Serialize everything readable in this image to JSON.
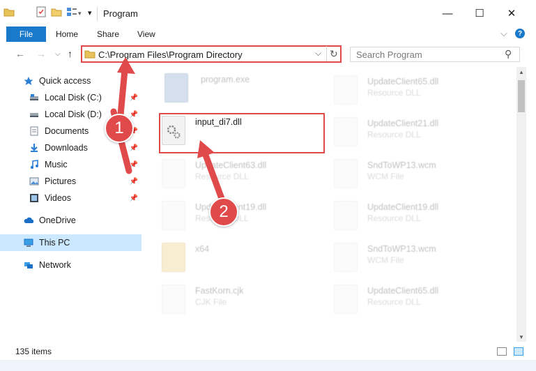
{
  "window": {
    "title": "Program",
    "minimize_glyph": "—",
    "maximize_glyph": "☐",
    "close_glyph": "✕"
  },
  "ribbon": {
    "tabs": [
      "File",
      "Home",
      "Share",
      "View"
    ],
    "help_glyph": "?",
    "expand_glyph": "⌵"
  },
  "nav": {
    "back_glyph": "←",
    "forward_glyph": "→",
    "recent_glyph": "⌵",
    "up_glyph": "↑",
    "address_path": "C:\\Program Files\\Program Directory",
    "address_dropdown_glyph": "⌵",
    "refresh_glyph": "↻",
    "search_placeholder": "Search Program",
    "search_glyph": "⚲"
  },
  "sidebar": {
    "items": [
      {
        "label": "Quick access",
        "icon": "star-icon",
        "pinned": false
      },
      {
        "label": "Local Disk (C:)",
        "icon": "drive-icon",
        "pinned": true
      },
      {
        "label": "Local Disk (D:)",
        "icon": "drive-icon",
        "pinned": true
      },
      {
        "label": "Documents",
        "icon": "documents-icon",
        "pinned": true
      },
      {
        "label": "Downloads",
        "icon": "download-icon",
        "pinned": true
      },
      {
        "label": "Music",
        "icon": "music-icon",
        "pinned": true
      },
      {
        "label": "Pictures",
        "icon": "pictures-icon",
        "pinned": true
      },
      {
        "label": "Videos",
        "icon": "videos-icon",
        "pinned": true
      },
      {
        "label": "OneDrive",
        "icon": "cloud-icon",
        "pinned": false
      },
      {
        "label": "This PC",
        "icon": "computer-icon",
        "pinned": false,
        "selected": true
      },
      {
        "label": "Network",
        "icon": "network-icon",
        "pinned": false
      }
    ],
    "pin_glyph": "📌"
  },
  "files": {
    "left": [
      {
        "name": "program.exe",
        "type": ""
      },
      {
        "name": "input_di7.dll",
        "type": ""
      },
      {
        "name": "UpdateClient63.dll",
        "type": "Resource DLL"
      },
      {
        "name": "UpdateClient19.dll",
        "type": "Resource DLL"
      },
      {
        "name": "x64",
        "type": ""
      },
      {
        "name": "FastKorn.cjk",
        "type": "CJK File"
      }
    ],
    "right": [
      {
        "name": "UpdateClient65.dll",
        "type": "Resource DLL"
      },
      {
        "name": "UpdateClient21.dll",
        "type": "Resource DLL"
      },
      {
        "name": "SndToWP13.wcm",
        "type": "WCM File"
      },
      {
        "name": "UpdateClient19.dll",
        "type": "Resource DLL"
      },
      {
        "name": "SndToWP13.wcm",
        "type": "WCM File"
      },
      {
        "name": "UpdateClient65.dll",
        "type": "Resource DLL"
      }
    ]
  },
  "callouts": {
    "first": "1",
    "second": "2"
  },
  "status": {
    "item_count": "135 items"
  },
  "colors": {
    "accent": "#1979ca",
    "callout_red": "#e14a4a",
    "selection": "#cce8ff"
  }
}
